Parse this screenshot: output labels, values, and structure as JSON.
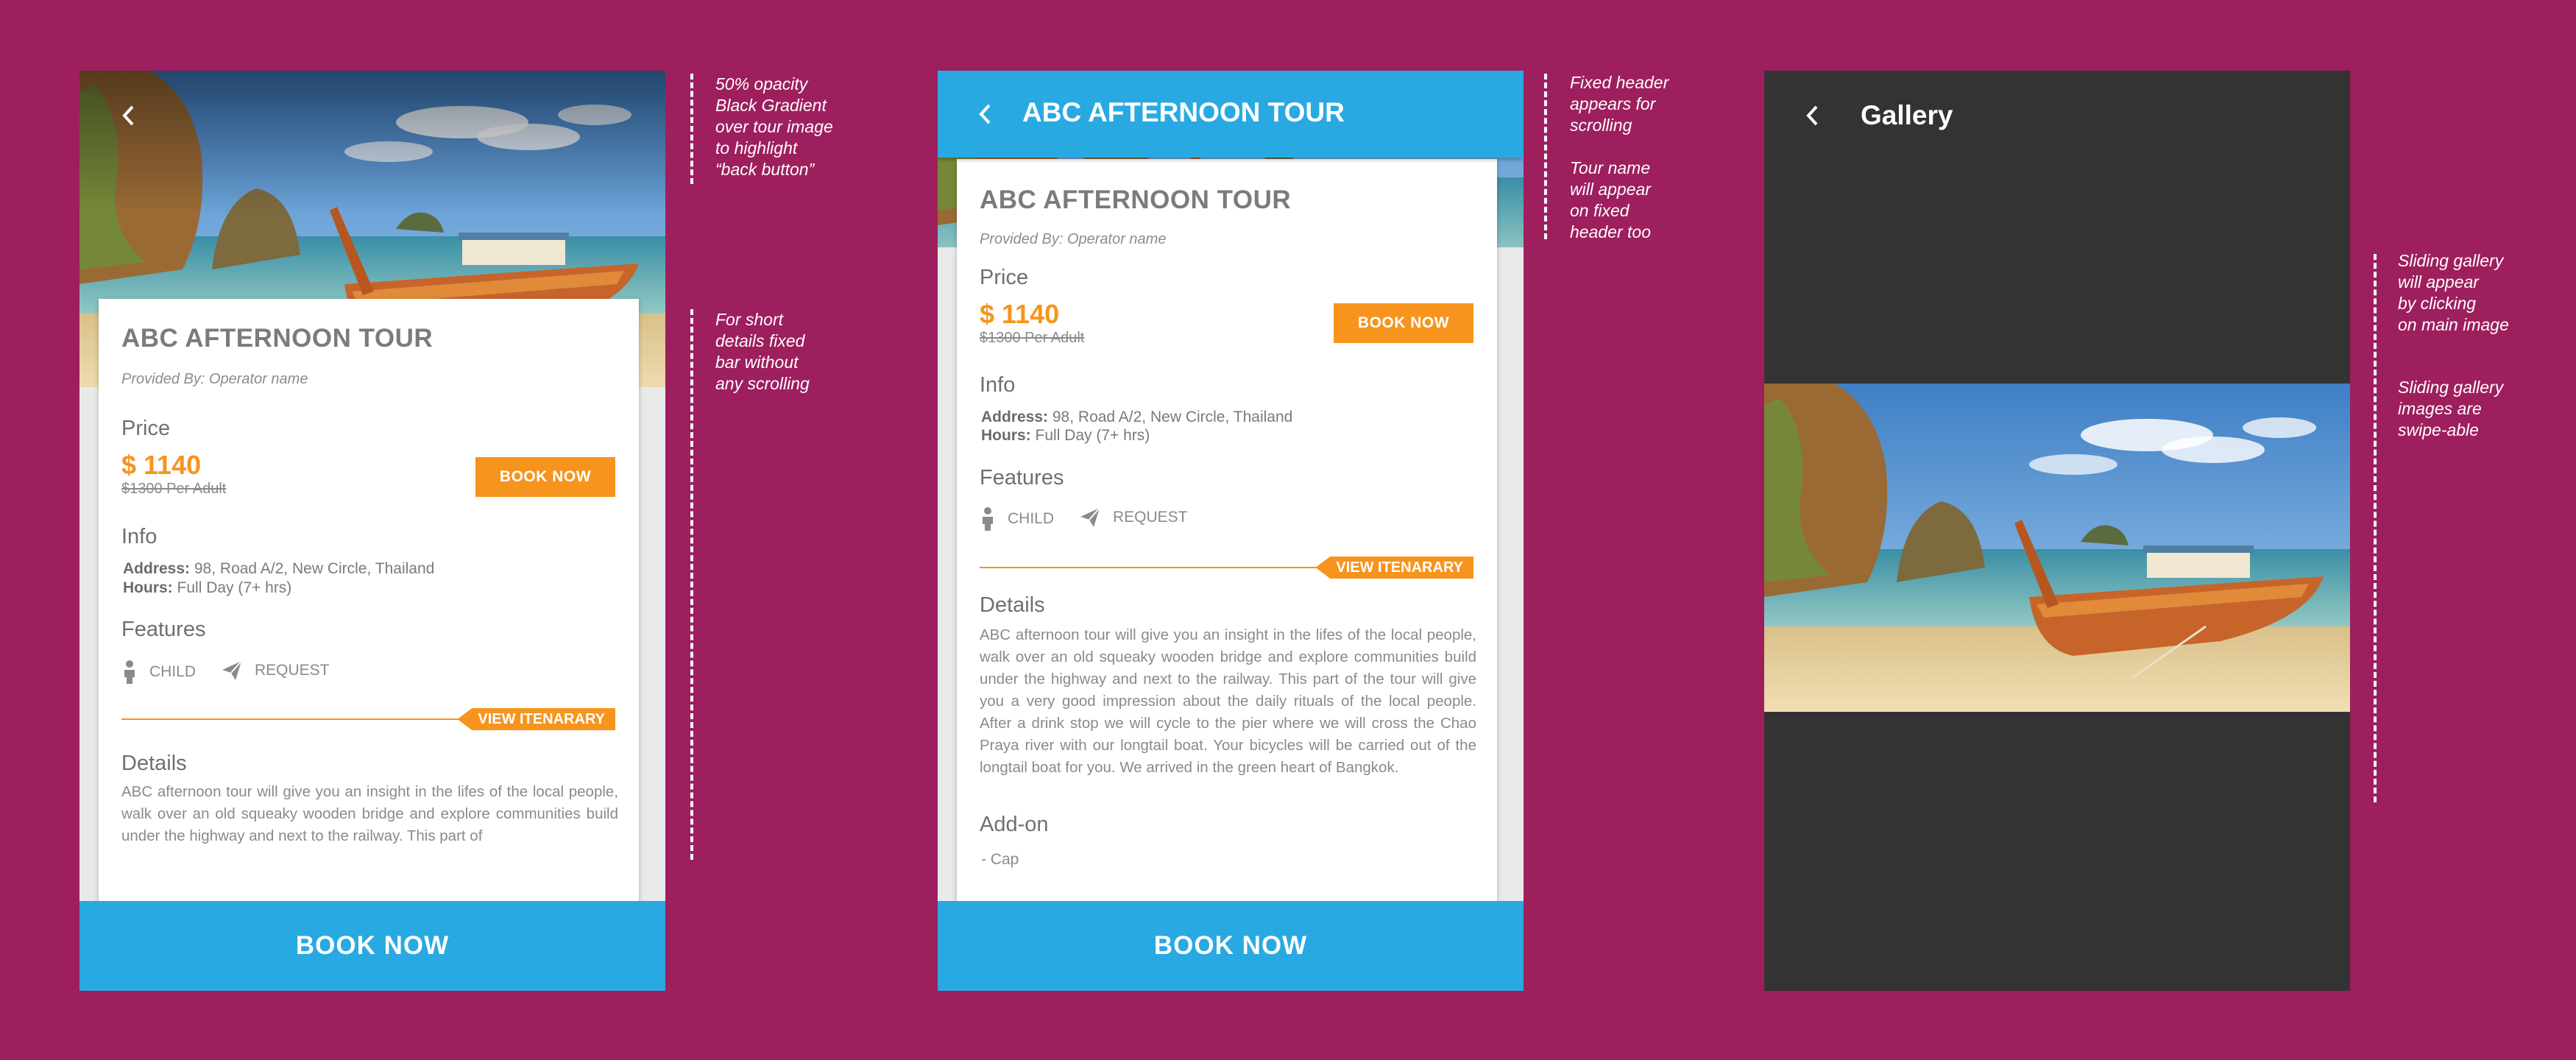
{
  "colors": {
    "background": "#9e1f5e",
    "accent_blue": "#29a9e1",
    "accent_orange": "#f7941d",
    "gallery_bg": "#333333"
  },
  "screen1": {
    "back_icon": "chevron-left-icon",
    "tour_title": "ABC AFTERNOON TOUR",
    "provider": "Provided By: Operator name",
    "price_heading": "Price",
    "price": "$ 1140",
    "old_price": "$1300 Per Adult",
    "book_small": "BOOK NOW",
    "info_heading": "Info",
    "address_label": "Address:",
    "address_value": "98, Road A/2, New Circle, Thailand",
    "hours_label": "Hours:",
    "hours_value": "Full Day (7+ hrs)",
    "features_heading": "Features",
    "feature_child": "CHILD",
    "feature_request": "REQUEST",
    "itinerary": "VIEW ITENARARY",
    "details_heading": "Details",
    "details_text": "ABC afternoon tour will give you an insight in the lifes of the local people, walk over an old squeaky wooden bridge and explore communities build under the highway and next to the railway. This part of",
    "footer_book": "BOOK NOW"
  },
  "screen2": {
    "header_title": "ABC AFTERNOON TOUR",
    "tour_title": "ABC AFTERNOON TOUR",
    "provider": "Provided By: Operator name",
    "price_heading": "Price",
    "price": "$ 1140",
    "old_price": "$1300 Per Adult",
    "book_small": "BOOK NOW",
    "info_heading": "Info",
    "address_label": "Address:",
    "address_value": "98, Road A/2, New Circle, Thailand",
    "hours_label": "Hours:",
    "hours_value": "Full Day (7+ hrs)",
    "features_heading": "Features",
    "feature_child": "CHILD",
    "feature_request": "REQUEST",
    "itinerary": "VIEW ITENARARY",
    "details_heading": "Details",
    "details_text": "ABC afternoon tour will give you an insight in the lifes of the local people, walk over an old squeaky wooden bridge and explore communities build under the highway and next to the railway. This part of the tour will give you a very good impression about the daily rituals of the local people. After a drink stop we will cycle to the pier where we will cross the Chao Praya river with our longtail boat. Your bicycles will be carried out of the longtail boat for you. We arrived in the green heart of Bangkok.",
    "addon_heading": "Add-on",
    "addon_item": "- Cap",
    "footer_book": "BOOK NOW"
  },
  "screen3": {
    "header_title": "Gallery"
  },
  "notes": {
    "n1": [
      "50% opacity",
      "Black Gradient",
      "over tour image",
      "to highlight",
      "“back button”"
    ],
    "n2": [
      "For short",
      "details fixed",
      "bar without",
      "any scrolling"
    ],
    "n3": [
      "Fixed header",
      "appears for",
      "scrolling"
    ],
    "n4": [
      "Tour name",
      "will appear",
      "on fixed",
      "header too"
    ],
    "n5": [
      "Sliding gallery",
      "will appear",
      "by clicking",
      "on main image"
    ],
    "n6": [
      "Sliding gallery",
      "images are",
      "swipe-able"
    ]
  }
}
